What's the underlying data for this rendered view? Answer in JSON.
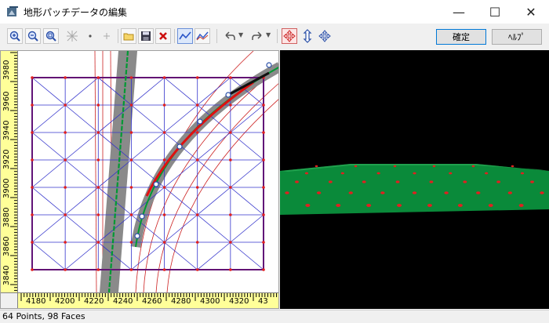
{
  "window": {
    "title": "地形パッチデータの編集",
    "controls": {
      "minimize": "—",
      "maximize": "☐",
      "close": "✕"
    }
  },
  "toolbar": {
    "tools": [
      {
        "name": "zoom-in-icon",
        "glyph": "+"
      },
      {
        "name": "zoom-out-icon",
        "glyph": "−"
      },
      {
        "name": "zoom-fit-icon",
        "glyph": "□"
      },
      {
        "name": "grid-points-icon",
        "glyph": "⁘"
      },
      {
        "name": "point-icon",
        "glyph": "•"
      },
      {
        "name": "add-point-icon",
        "glyph": "+"
      },
      {
        "name": "open-folder-icon",
        "glyph": "📁"
      },
      {
        "name": "save-icon",
        "glyph": "💾"
      },
      {
        "name": "delete-icon",
        "glyph": "✖"
      },
      {
        "name": "line-view-icon",
        "glyph": "∿"
      },
      {
        "name": "line-view-alt-icon",
        "glyph": "∿"
      },
      {
        "name": "undo-icon",
        "glyph": "↶"
      },
      {
        "name": "redo-icon",
        "glyph": "↷"
      },
      {
        "name": "move-red-icon",
        "glyph": "✥"
      },
      {
        "name": "vertical-arrows-icon",
        "glyph": "⇳"
      },
      {
        "name": "move-blue-icon",
        "glyph": "✥"
      }
    ],
    "ok_label": "確定",
    "help_label": "ﾍﾙﾌﾟ"
  },
  "rulers": {
    "vertical": [
      "3980",
      "3960",
      "3940",
      "3920",
      "3900",
      "3880",
      "3860",
      "3840"
    ],
    "horizontal": [
      "4180",
      "4200",
      "4220",
      "4240",
      "4260",
      "4280",
      "4300",
      "4320",
      "43"
    ]
  },
  "status": {
    "text": "64 Points, 98 Faces"
  },
  "colors": {
    "ruler_bg": "#ffff99",
    "patch_border": "#800040",
    "mesh_lines": "#3333cc",
    "mesh_points": "#e02020",
    "road_gray": "#808080",
    "road_center_green": "#009933",
    "road_edge_red": "#cc0000",
    "terrain_green": "#0a8a3a",
    "view3d_bg": "#000000"
  }
}
